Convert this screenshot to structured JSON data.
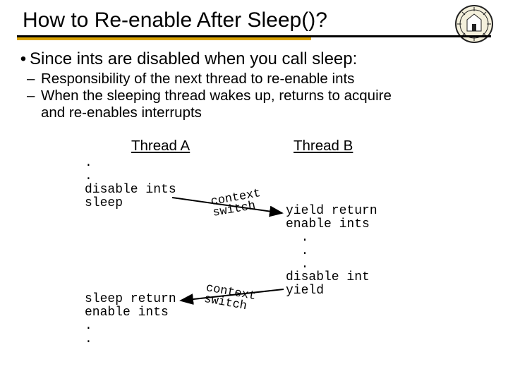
{
  "title": "How to Re-enable After Sleep()?",
  "bullet": "Since ints are disabled when you call sleep:",
  "sub1": "Responsibility of the next thread to re-enable ints",
  "sub2a": "When the sleeping thread wakes up, returns to acquire",
  "sub2b": "and re-enables interrupts",
  "colA": "Thread A",
  "colB": "Thread B",
  "codeA1": ".\n.\ndisable ints\nsleep",
  "codeA2": "sleep return\nenable ints\n.\n.",
  "codeB1": "yield return\nenable ints\n  .\n  .\n  .\ndisable int\nyield",
  "cs1a": "context",
  "cs1b": "switch",
  "cs2a": "context",
  "cs2b": "switch",
  "rot1": "-10",
  "rot2": "10"
}
